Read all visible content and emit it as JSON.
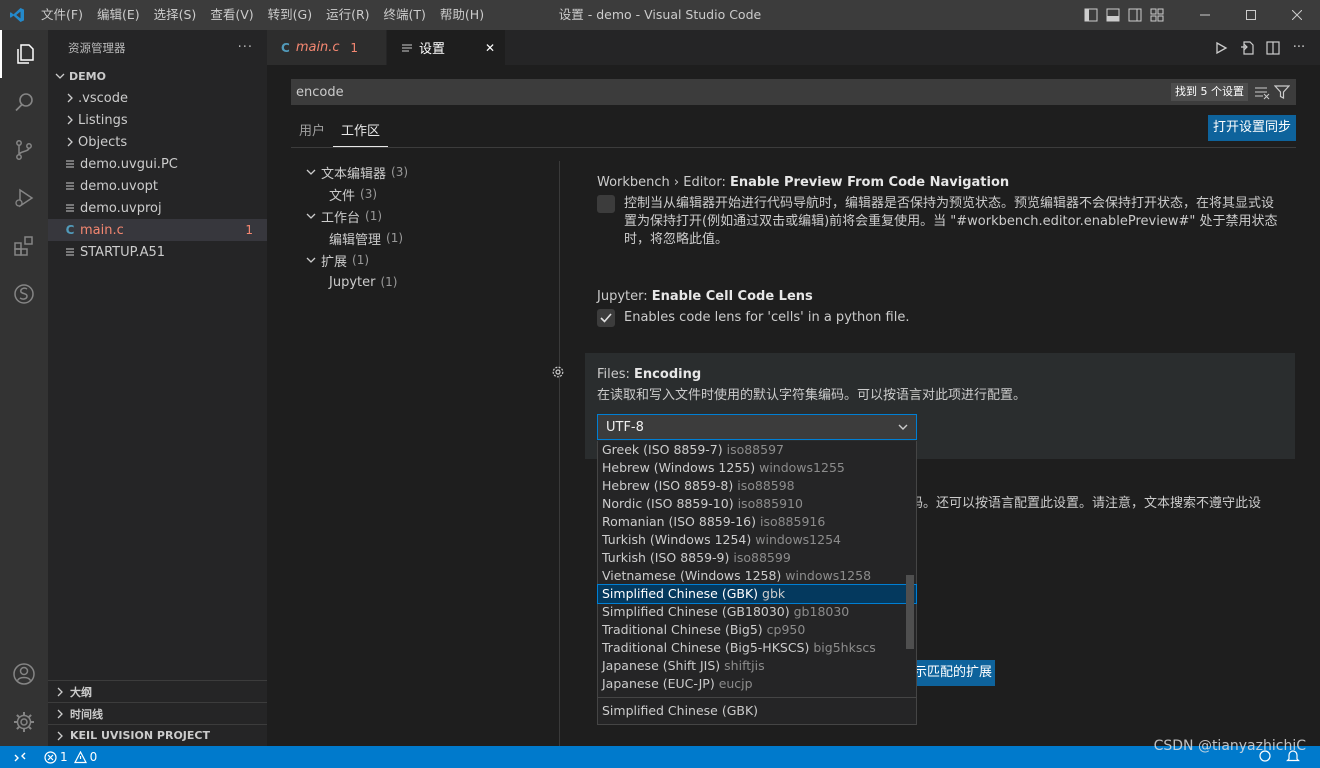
{
  "titlebar": {
    "title": "设置 - demo - Visual Studio Code",
    "menus": [
      "文件(F)",
      "编辑(E)",
      "选择(S)",
      "查看(V)",
      "转到(G)",
      "运行(R)",
      "终端(T)",
      "帮助(H)"
    ]
  },
  "sidebar": {
    "header": "资源管理器",
    "more": "···",
    "folder": "DEMO",
    "items": [
      {
        "label": ".vscode",
        "kind": "folder"
      },
      {
        "label": "Listings",
        "kind": "folder"
      },
      {
        "label": "Objects",
        "kind": "folder"
      },
      {
        "label": "demo.uvgui.PC",
        "kind": "file"
      },
      {
        "label": "demo.uvopt",
        "kind": "file"
      },
      {
        "label": "demo.uvproj",
        "kind": "file"
      },
      {
        "label": "main.c",
        "kind": "c",
        "badge": "1"
      },
      {
        "label": "STARTUP.A51",
        "kind": "file"
      }
    ],
    "bottom_sections": [
      "大纲",
      "时间线",
      "KEIL UVISION PROJECT"
    ]
  },
  "tabs": [
    {
      "label": "main.c",
      "badge": "1",
      "icon": "C"
    },
    {
      "label": "设置",
      "close": "✕"
    }
  ],
  "settings": {
    "search_value": "encode",
    "found_count": "找到 5 个设置",
    "scope_tabs": [
      "用户",
      "工作区"
    ],
    "sync_button": "打开设置同步",
    "toc": [
      {
        "label": "文本编辑器",
        "count": "(3)",
        "level": 0
      },
      {
        "label": "文件",
        "count": "(3)",
        "level": 1
      },
      {
        "label": "工作台",
        "count": "(1)",
        "level": 0
      },
      {
        "label": "编辑管理",
        "count": "(1)",
        "level": 1
      },
      {
        "label": "扩展",
        "count": "(1)",
        "level": 0
      },
      {
        "label": "Jupyter",
        "count": "(1)",
        "level": 1
      }
    ],
    "items": {
      "preview": {
        "category": "Workbench › Editor: ",
        "name": "Enable Preview From Code Navigation",
        "desc": "控制当从编辑器开始进行代码导航时，编辑器是否保持为预览状态。预览编辑器不会保持打开状态，在将其显式设置为保持打开(例如通过双击或编辑)前将会重复使用。当 \"#workbench.editor.enablePreview#\" 处于禁用状态时，将忽略此值。"
      },
      "jupyter": {
        "category": "Jupyter: ",
        "name": "Enable Cell Code Lens",
        "desc": "Enables code lens for 'cells' in a python file."
      },
      "encoding": {
        "category": "Files: ",
        "name": "Encoding",
        "desc": "在读取和写入文件时使用的默认字符集编码。可以按语言对此项进行配置。",
        "value": "UTF-8"
      }
    },
    "behind_text": "码。还可以按语言配置此设置。请注意，文本搜索不遵守此设",
    "behind_button": "示匹配的扩展"
  },
  "dropdown": {
    "options": [
      {
        "name": "Greek (ISO 8859-7)",
        "alias": "iso88597"
      },
      {
        "name": "Hebrew (Windows 1255)",
        "alias": "windows1255"
      },
      {
        "name": "Hebrew (ISO 8859-8)",
        "alias": "iso88598"
      },
      {
        "name": "Nordic (ISO 8859-10)",
        "alias": "iso885910"
      },
      {
        "name": "Romanian (ISO 8859-16)",
        "alias": "iso885916"
      },
      {
        "name": "Turkish (Windows 1254)",
        "alias": "windows1254"
      },
      {
        "name": "Turkish (ISO 8859-9)",
        "alias": "iso88599"
      },
      {
        "name": "Vietnamese (Windows 1258)",
        "alias": "windows1258"
      },
      {
        "name": "Simplified Chinese (GBK)",
        "alias": "gbk",
        "selected": true
      },
      {
        "name": "Simplified Chinese (GB18030)",
        "alias": "gb18030"
      },
      {
        "name": "Traditional Chinese (Big5)",
        "alias": "cp950"
      },
      {
        "name": "Traditional Chinese (Big5-HKSCS)",
        "alias": "big5hkscs"
      },
      {
        "name": "Japanese (Shift JIS)",
        "alias": "shiftjis"
      },
      {
        "name": "Japanese (EUC-JP)",
        "alias": "eucjp"
      }
    ],
    "description": "Simplified Chinese (GBK)"
  },
  "statusbar": {
    "errors": "1",
    "warnings": "0"
  },
  "watermark": "CSDN @tianyazhichiC",
  "colors": {
    "accent": "#007acc",
    "button": "#0e639c",
    "error": "#f48771"
  }
}
